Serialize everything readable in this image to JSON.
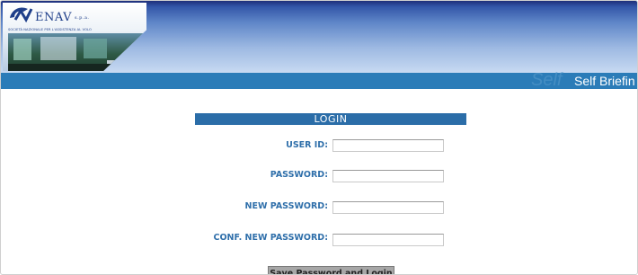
{
  "brand": {
    "name": "ENAV",
    "suffix": "s.p.a.",
    "tagline": "SOCIETÀ NAZIONALE PER L'ASSISTENZA AL VOLO"
  },
  "banner": {
    "watermark": "Self",
    "title": "Self Briefin"
  },
  "login": {
    "header": "LOGIN",
    "user_id_label": "USER ID:",
    "user_id_value": "",
    "password_label": "PASSWORD:",
    "password_value": "",
    "new_password_label": "NEW PASSWORD:",
    "new_password_value": "",
    "conf_new_password_label": "CONF. NEW PASSWORD:",
    "conf_new_password_value": "",
    "submit_label": "Save Password and Login"
  },
  "colors": {
    "header_blue": "#2b7cb8",
    "login_header": "#2b6da8",
    "label_blue": "#2f6faa"
  }
}
